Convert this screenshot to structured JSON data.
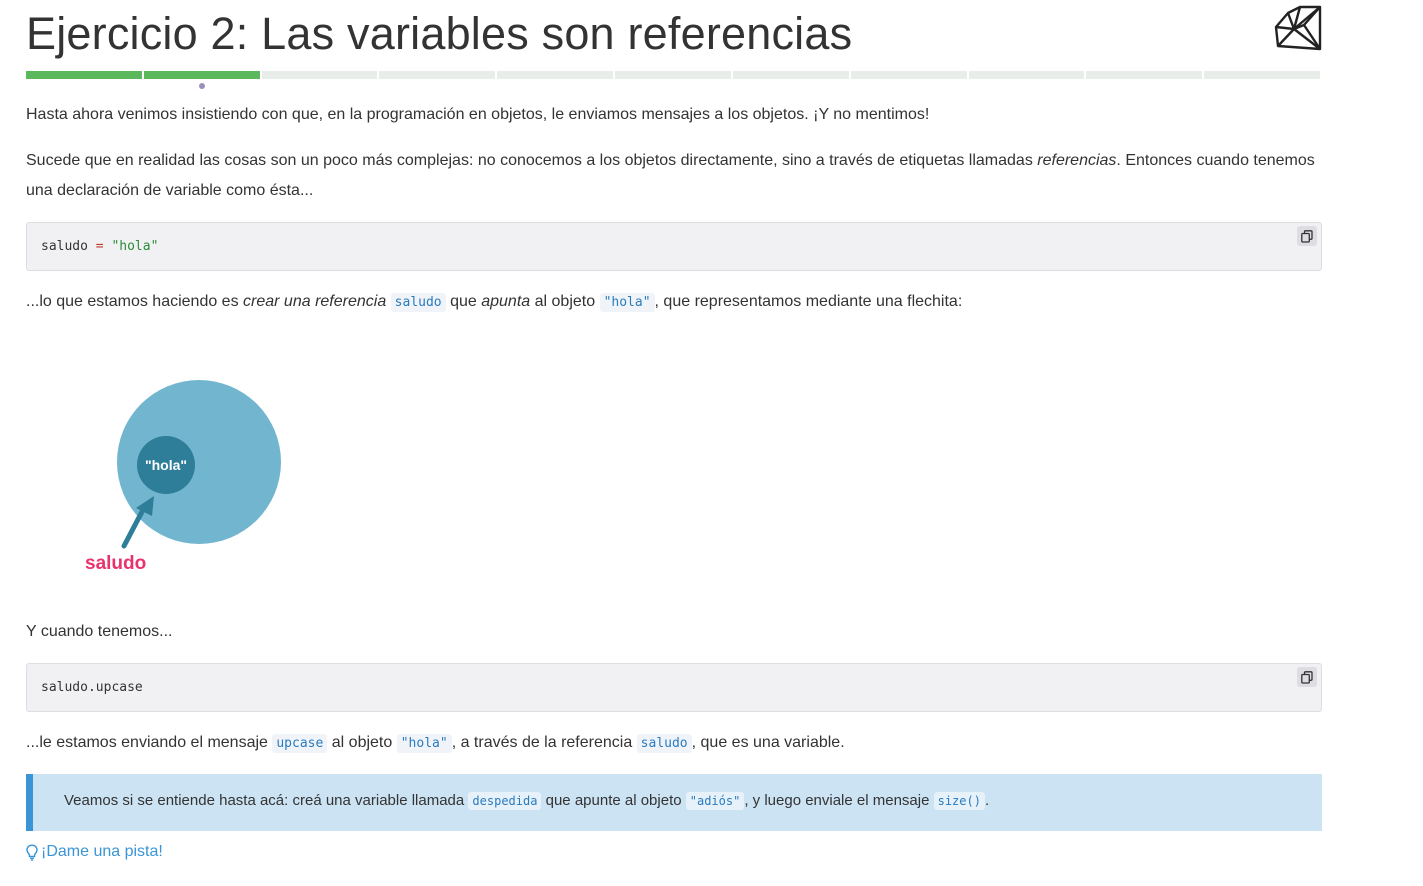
{
  "exercise": {
    "title": "Ejercicio 2: Las variables son referencias",
    "progress": {
      "total_steps": 11,
      "completed_steps": 2,
      "current_step": 2
    }
  },
  "content": {
    "p1": "Hasta ahora venimos insistiendo con que, en la programación en objetos, le enviamos mensajes a los objetos. ¡Y no mentimos!",
    "p2_a": "Sucede que en realidad las cosas son un poco más complejas: no conocemos a los objetos directamente, sino a través de etiquetas llamadas ",
    "p2_em": "referencias",
    "p2_b": ". Entonces cuando tenemos una declaración de variable como ésta...",
    "code1": {
      "var": "saludo",
      "op": "=",
      "str": "\"hola\""
    },
    "p3_a": "...lo que estamos haciendo es ",
    "p3_em1": "crear una referencia",
    "p3_code1": "saludo",
    "p3_b": " que ",
    "p3_em2": "apunta",
    "p3_c": " al objeto ",
    "p3_code2": "\"hola\"",
    "p3_d": ", que representamos mediante una flechita:",
    "diagram": {
      "object_label": "\"hola\"",
      "reference_label": "saludo",
      "object_color": "#2e7d99",
      "circle_color": "#72b5cf",
      "reference_color": "#e8336d"
    },
    "p4": "Y cuando tenemos...",
    "code2": "saludo.upcase",
    "p5_a": "...le estamos enviando el mensaje ",
    "p5_code1": "upcase",
    "p5_b": " al objeto ",
    "p5_code2": "\"hola\"",
    "p5_c": ", a través de la referencia ",
    "p5_code3": "saludo",
    "p5_d": ", que es una variable."
  },
  "callout": {
    "a": "Veamos si se entiende hasta acá: creá una variable llamada ",
    "code1": "despedida",
    "b": " que apunte al objeto ",
    "code2": "\"adiós\"",
    "c": ", y luego enviale el mensaje ",
    "code3": "size()",
    "d": "."
  },
  "hint": {
    "label": "¡Dame una pista!",
    "icon": "lightbulb-icon"
  },
  "icons": {
    "logo": "ruby-logo-icon",
    "copy": "copy-icon"
  },
  "colors": {
    "progress_done": "#5cb85c",
    "link": "#3a95d6",
    "callout_bg": "#cce3f4",
    "callout_border": "#3a95d6"
  }
}
